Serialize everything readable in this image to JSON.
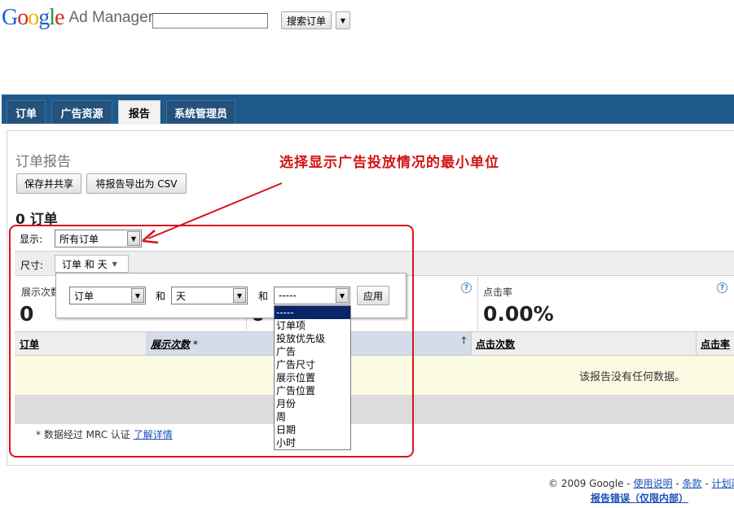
{
  "header": {
    "logo_google": "Google",
    "logo_product": "Ad Manager",
    "search_value": "",
    "search_button": "搜索订单"
  },
  "tabs": [
    {
      "label": "订单",
      "active": false
    },
    {
      "label": "广告资源",
      "active": false
    },
    {
      "label": "报告",
      "active": true
    },
    {
      "label": "系统管理员",
      "active": false
    }
  ],
  "report": {
    "title": "订单报告",
    "save_share_button": "保存并共享",
    "export_csv_button": "将报告导出为 CSV",
    "count_heading": "0 订单",
    "show_label": "显示:",
    "show_value": "所有订单",
    "dimension_label": "尺寸:",
    "dimension_value": "订单 和 天"
  },
  "dimension_popup": {
    "first_value": "订单",
    "and_1": "和",
    "second_value": "天",
    "and_2": "和",
    "third_value": "-----",
    "apply_button": "应用",
    "options": [
      "-----",
      "订单项",
      "投放优先级",
      "广告",
      "广告尺寸",
      "展示位置",
      "广告位置",
      "月份",
      "周",
      "日期",
      "小时"
    ],
    "selected_index": 0
  },
  "stats": [
    {
      "label": "展示次数",
      "value": "0"
    },
    {
      "label": "点击次数",
      "value": "0"
    },
    {
      "label": "点击率",
      "value": "0.00%"
    }
  ],
  "table": {
    "columns": [
      "订单",
      "展示次数",
      "点击次数",
      "点击率"
    ],
    "sorted_marker": "*",
    "sort_arrow": "↑",
    "empty_message": "该报告没有任何数据。"
  },
  "notes": {
    "mrc_note": "* 数据经过 MRC 认证",
    "learn_more": "了解详情"
  },
  "annotation": {
    "text": "选择显示广告投放情况的最小单位",
    "color": "#d41313"
  },
  "footer": {
    "copyright": "© 2009 Google -",
    "link_help": "使用说明",
    "sep1": "-",
    "link_terms": "条款",
    "sep2": "-",
    "link_policy": "计划政策",
    "report_bug": "报告错误（仅限内部）"
  },
  "colors": {
    "tabbar": "#1f5a8a",
    "link": "#1a4fb8",
    "annotation_red": "#d8141b"
  }
}
